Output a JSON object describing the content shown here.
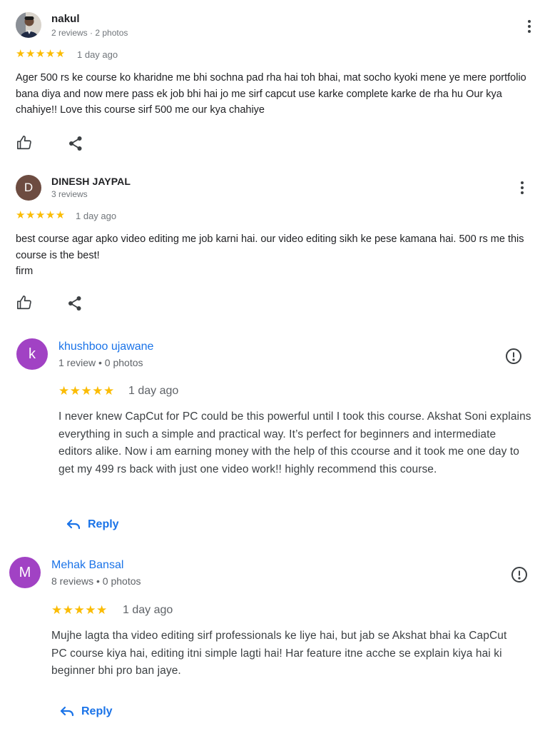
{
  "reviews": [
    {
      "name": "nakul",
      "meta": "2 reviews · 2 photos",
      "stars": "★★★★★",
      "time": "1 day ago",
      "text": "Ager 500 rs ke course ko kharidne me bhi sochna pad rha hai toh bhai, mat socho kyoki mene ye mere portfolio bana diya and now mere pass ek job bhi hai jo me sirf capcut use karke complete karke de rha hu Our kya chahiye!! Love this course sirf 500 me our kya chahiye"
    },
    {
      "name": "DINESH JAYPAL",
      "initial": "D",
      "meta": "3 reviews",
      "stars": "★★★★★",
      "time": "1 day ago",
      "text_line1": "best course agar apko video editing me job karni hai. our video editing sikh ke pese kamana hai. 500 rs me this course is the best!",
      "text_line2": "firm"
    },
    {
      "name": "khushboo ujawane",
      "initial": "k",
      "meta": "1 review • 0 photos",
      "stars": "★★★★★",
      "time": "1 day ago",
      "text": "I never knew CapCut for PC could be this powerful until I took this course. Akshat Soni explains everything in such a simple and practical way. It’s perfect for beginners and intermediate editors alike. Now i am earning money with the help of this ccourse and it took me one day to get my 499 rs back with just one video work!! highly recommend this course.",
      "reply_label": "Reply"
    },
    {
      "name": "Mehak Bansal",
      "initial": "M",
      "meta": "8 reviews • 0 photos",
      "stars": "★★★★★",
      "time": "1 day ago",
      "text": "Mujhe lagta tha video editing sirf professionals ke liye hai, but jab se Akshat bhai ka CapCut PC course kiya hai, editing itni simple lagti hai! Har feature itne acche se explain kiya hai ki beginner bhi pro ban jaye.",
      "reply_label": "Reply"
    }
  ],
  "colors": {
    "star": "#fbbc04",
    "link_blue": "#1a73e8",
    "avatar_brown": "#6d4c41",
    "avatar_purple": "#a142c4"
  }
}
